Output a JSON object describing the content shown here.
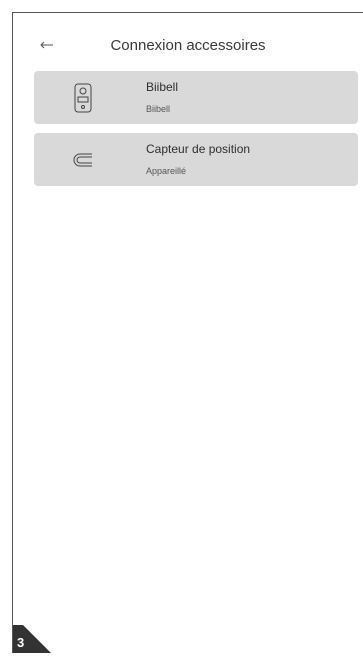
{
  "header": {
    "back_icon": "arrow-left-icon",
    "title": "Connexion accessoires"
  },
  "accessories": [
    {
      "icon": "doorbell-icon",
      "name": "Biibell",
      "status": "Biibell"
    },
    {
      "icon": "magnet-sensor-icon",
      "name": "Capteur de position",
      "status": "Appareillé"
    }
  ],
  "page_badge": {
    "number": "3"
  },
  "colors": {
    "card_background": "#d9d9d9",
    "badge_background": "#333333"
  }
}
